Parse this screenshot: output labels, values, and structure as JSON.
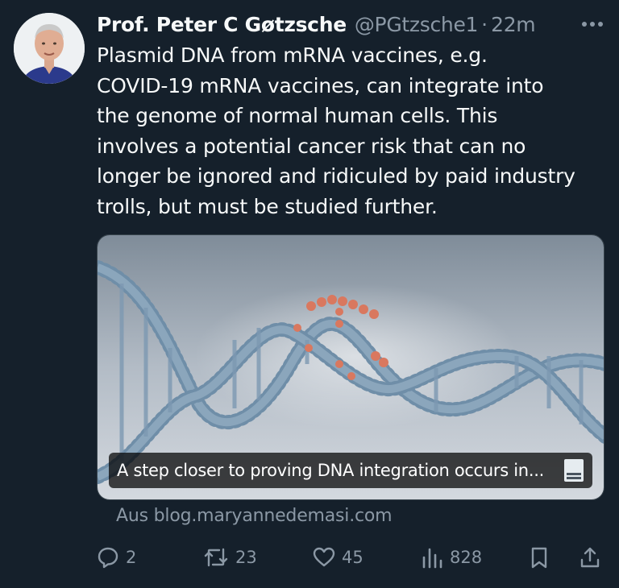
{
  "author": {
    "name": "Prof. Peter C Gøtzsche",
    "handle": "@PGtzsche1",
    "separator": "·",
    "time": "22m"
  },
  "tweet": {
    "lines": [
      "Plasmid DNA from mRNA vaccines, e.g.",
      "COVID-19 mRNA vaccines, can integrate into",
      "the genome of normal human cells. This",
      "involves a potential cancer risk that can no",
      "longer be ignored and ridiculed by paid industry",
      "trolls, but must be studied further."
    ]
  },
  "card": {
    "caption": "A step closer to proving DNA integration occurs in...",
    "image_icon": "dna-helix-image",
    "source": "Aus blog.maryannedemasi.com"
  },
  "actions": {
    "replies": "2",
    "reposts": "23",
    "likes": "45",
    "views": "828"
  },
  "colors": {
    "background": "#15202b",
    "text": "#f7f9f9",
    "muted": "#8b98a5"
  }
}
